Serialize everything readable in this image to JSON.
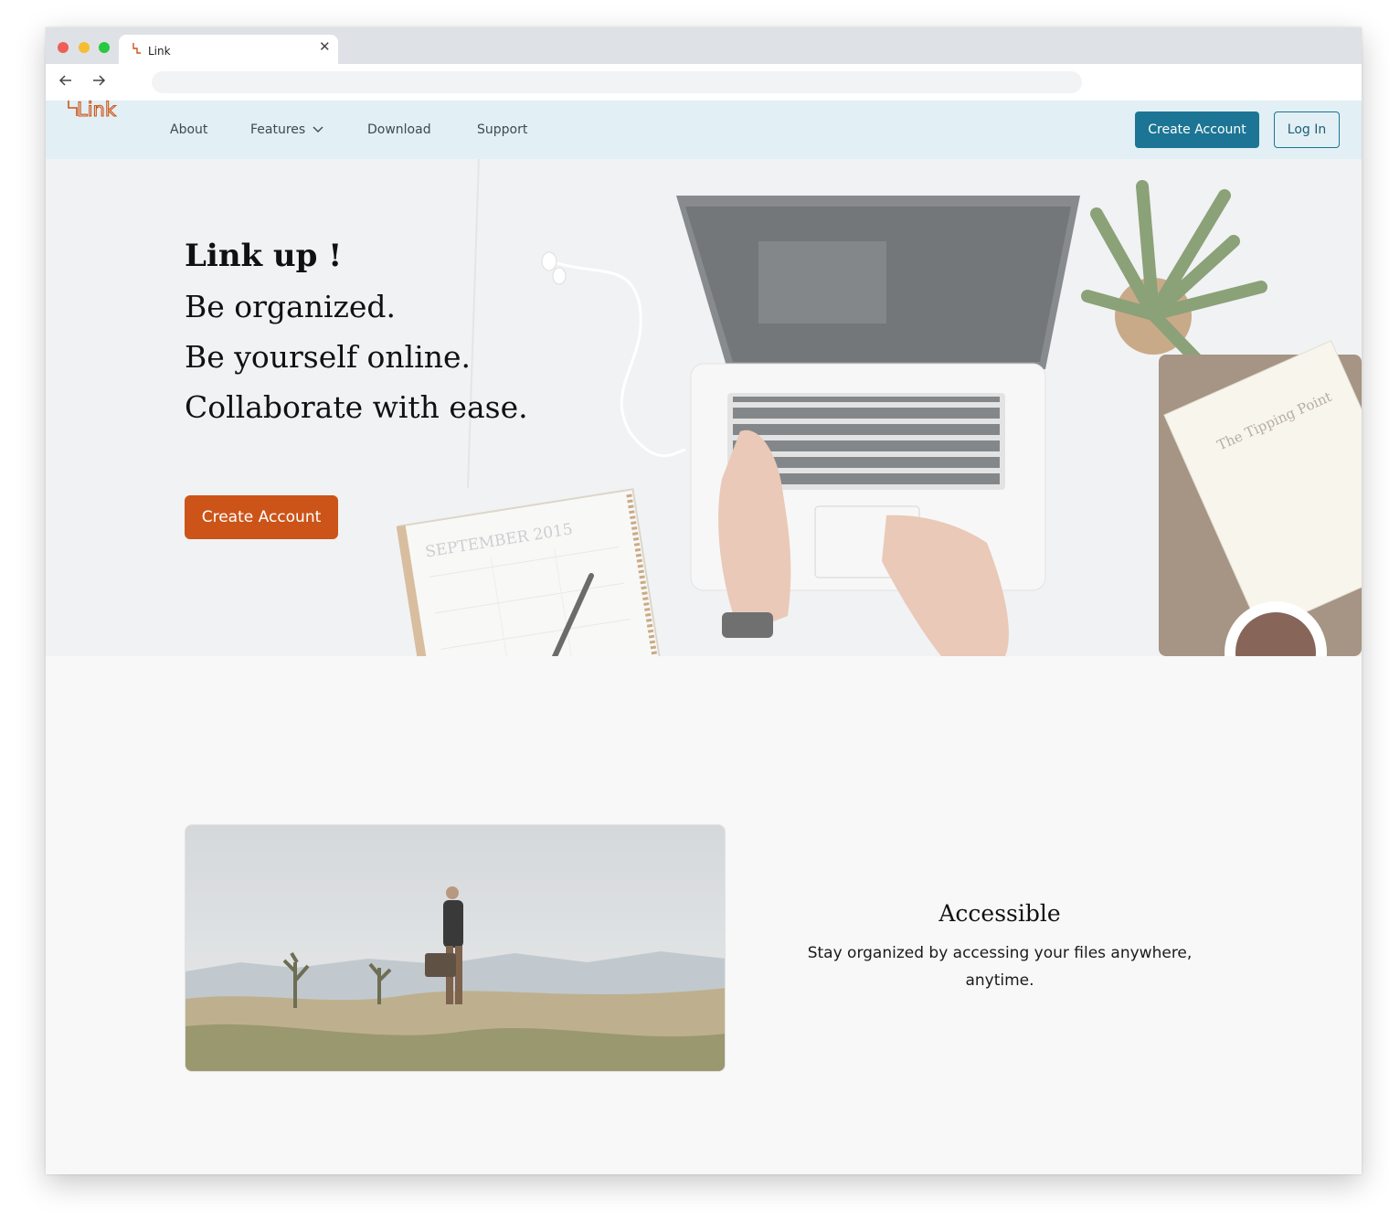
{
  "browser": {
    "tab_title": "Link",
    "url": ""
  },
  "header": {
    "logo": "Link",
    "nav": {
      "about": "About",
      "features": "Features",
      "download": "Download",
      "support": "Support"
    },
    "create_account": "Create Account",
    "login": "Log In"
  },
  "hero": {
    "title": "Link up !",
    "lines": [
      "Be organized.",
      "Be yourself online.",
      "Collaborate with ease."
    ],
    "cta": "Create Account",
    "calendar_text": "SEPTEMBER 2015",
    "book_title": "The Tipping Point"
  },
  "feature": {
    "title": "Accessible",
    "description": "Stay organized by accessing your files anywhere, anytime."
  },
  "colors": {
    "primary_teal": "#1c7594",
    "accent_orange": "#cc5418",
    "header_bg": "#e2eff4",
    "page_bg": "#f8f8f8"
  }
}
